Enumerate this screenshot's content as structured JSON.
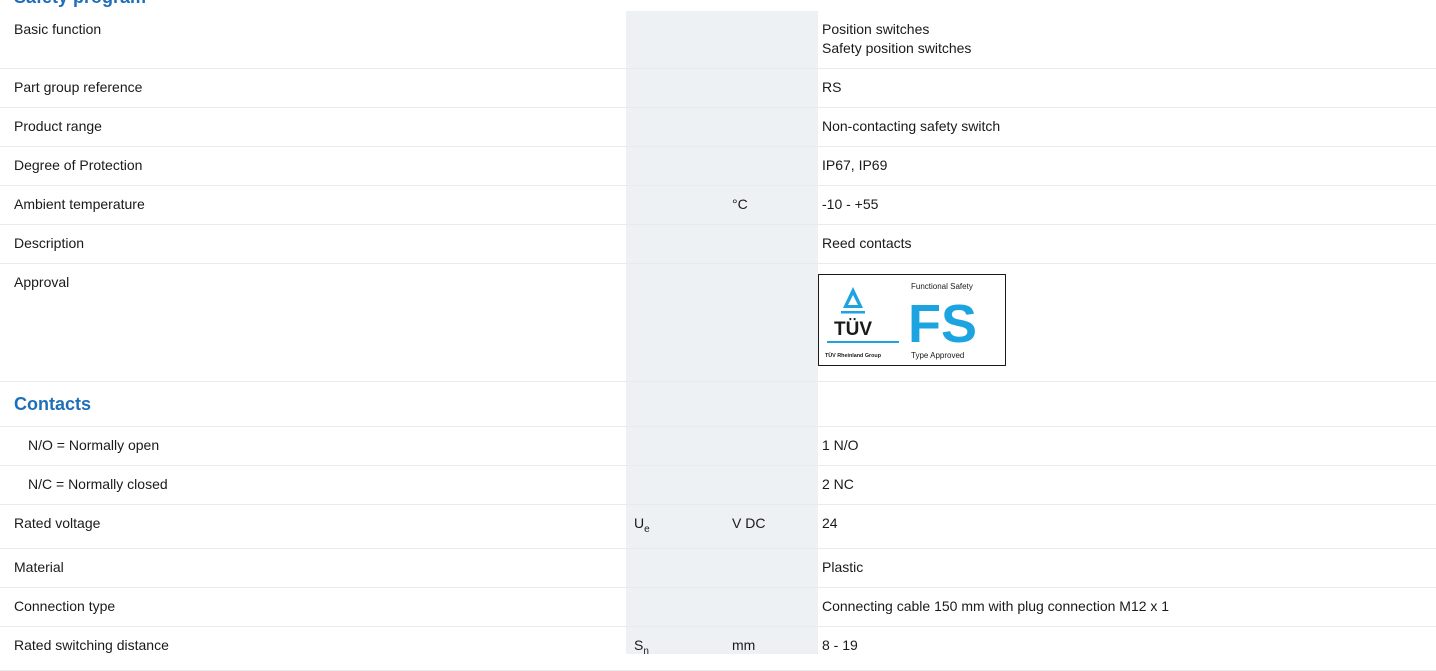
{
  "header": {
    "title": "Safety program"
  },
  "rows": [
    {
      "name": "Basic function",
      "symbol": "",
      "unit": "",
      "values": [
        "Position switches",
        "Safety position switches"
      ]
    },
    {
      "name": "Part group reference",
      "symbol": "",
      "unit": "",
      "value": "RS"
    },
    {
      "name": "Product range",
      "symbol": "",
      "unit": "",
      "value": "Non-contacting safety switch"
    },
    {
      "name": "Degree of Protection",
      "symbol": "",
      "unit": "",
      "value": "IP67, IP69"
    },
    {
      "name": "Ambient temperature",
      "symbol": "",
      "unit": "°C",
      "value": "-10 - +55"
    },
    {
      "name": "Description",
      "symbol": "",
      "unit": "",
      "value": "Reed contacts"
    },
    {
      "name": "Approval"
    }
  ],
  "approval_logo": {
    "brand": "TÜV",
    "group": "TÜV Rheinland Group",
    "top_label": "Functional Safety",
    "mark": "FS",
    "bottom_label": "Type Approved",
    "color": "#1ba4e0"
  },
  "contacts": {
    "title": "Contacts",
    "rows": [
      {
        "name": "N/O = Normally open",
        "value": "1 N/O"
      },
      {
        "name": "N/C = Normally closed",
        "value": "2 NC"
      }
    ]
  },
  "rows2": [
    {
      "name": "Rated voltage",
      "symbol": "U",
      "symbol_sub": "e",
      "unit": "V DC",
      "value": "24"
    },
    {
      "name": "Material",
      "symbol": "",
      "symbol_sub": "",
      "unit": "",
      "value": "Plastic"
    },
    {
      "name": "Connection type",
      "symbol": "",
      "symbol_sub": "",
      "unit": "",
      "value": "Connecting cable 150 mm with plug connection M12 x 1"
    },
    {
      "name": "Rated switching distance",
      "symbol": "S",
      "symbol_sub": "n",
      "unit": "mm",
      "value": "8 - 19"
    }
  ],
  "colors": {
    "accent": "#1f6fb8",
    "shade": "#eef1f4",
    "rule": "#e8ebee"
  }
}
